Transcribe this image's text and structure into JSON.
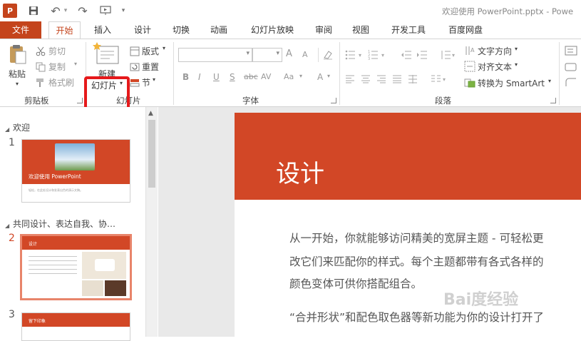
{
  "titlebar": {
    "app_icon": "P",
    "undo_glyph": "↶",
    "redo_glyph": "↷",
    "more_glyph": "▾",
    "title": "欢迎使用 PowerPoint.pptx - Powe"
  },
  "tabs": [
    "文件",
    "开始",
    "插入",
    "设计",
    "切换",
    "动画",
    "幻灯片放映",
    "审阅",
    "视图",
    "开发工具",
    "百度网盘"
  ],
  "ribbon": {
    "clipboard": {
      "paste": "粘贴",
      "cut": "剪切",
      "copy": "复制",
      "format_painter": "格式刷",
      "label": "剪贴板"
    },
    "slides": {
      "new_slide_line1": "新建",
      "new_slide_line2": "幻灯片",
      "layout": "版式",
      "reset": "重置",
      "section": "节",
      "label": "幻灯片"
    },
    "font": {
      "grow": "A",
      "shrink": "A",
      "bold": "B",
      "italic": "I",
      "underline": "U",
      "shadow": "S",
      "strike": "abc",
      "spacing": "AV",
      "case": "Aa",
      "color": "A",
      "label": "字体"
    },
    "paragraph": {
      "text_direction": "文字方向",
      "align_text": "对齐文本",
      "smartart": "转换为 SmartArt",
      "label": "段落"
    }
  },
  "slide_pane": {
    "sections": [
      {
        "title": "欢迎"
      },
      {
        "title": "共同设计、表达自我、协…"
      }
    ],
    "slides": [
      {
        "number": "1",
        "title": "欢迎使用 PowerPoint",
        "subtitle": "轻松，在此处设计和发表出色的演示文稿。"
      },
      {
        "number": "2",
        "title": "设计"
      },
      {
        "number": "3",
        "title": "留下印象"
      }
    ]
  },
  "slide": {
    "title": "设计",
    "body": [
      "从一开始，你就能够访问精美的宽屏主题 - 可轻松更",
      "改它们来匹配你的样式。每个主题都带有各式各样的",
      "颜色变体可供你搭配组合。",
      "“合并形状”和配色取色器等新功能为你的设计打开了"
    ]
  },
  "watermark": "Bai度经验",
  "colors": {
    "accent": "#d24726",
    "file_tab": "#c4441c",
    "highlight": "#e6191b"
  }
}
